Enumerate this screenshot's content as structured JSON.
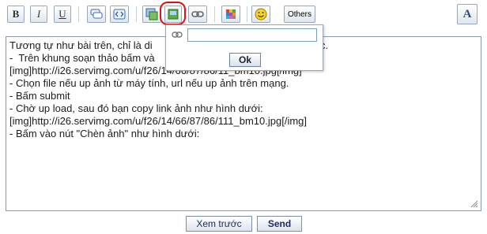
{
  "toolbar": {
    "bold_label": "B",
    "italic_label": "I",
    "underline_label": "U",
    "others_label": "Others",
    "font_size_glyph": "A"
  },
  "popup": {
    "url_value": "",
    "ok_label": "Ok"
  },
  "editor": {
    "lines": [
      "Tương tự như bài trên, chỉ là di",
      "khác.",
      "-  Trên khung soạn thảo bấm và",
      "[img]http://i26.servimg.com/u/f26/14/66/87/86/11_bm10.jpg[/img]",
      "- Chọn file nếu up ảnh từ máy tính, url nếu up ảnh trên mạng.",
      "- Bấm submit",
      "- Chờ up load, sau đó bạn copy link ảnh như hình dưới:",
      "[img]http://i26.servimg.com/u/f26/14/66/87/86/111_bm10.jpg[/img]",
      "- Bấm vào nút \"Chèn ảnh\" như hình dưới:"
    ]
  },
  "buttons": {
    "preview_label": "Xem trước",
    "send_label": "Send"
  },
  "colors": {
    "highlight_ring": "#e01010",
    "button_text": "#1a2a5a"
  }
}
